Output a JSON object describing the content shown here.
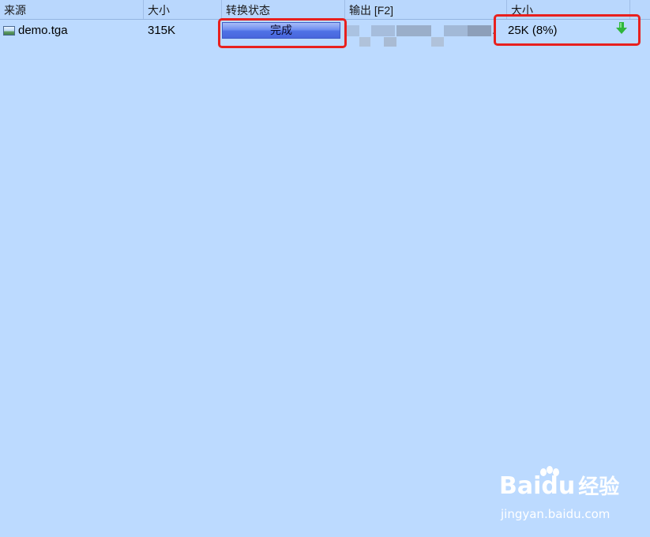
{
  "columns": [
    {
      "label": "来源"
    },
    {
      "label": "大小"
    },
    {
      "label": "转换状态"
    },
    {
      "label": "输出 [F2]"
    },
    {
      "label": "大小"
    }
  ],
  "rows": [
    {
      "source": "demo.tga",
      "size": "315K",
      "status": "完成",
      "status_progress": 1.0,
      "output": "",
      "output_size": "25K  (8%)"
    }
  ],
  "watermark": {
    "brand_left": "Bai",
    "brand_right": "du",
    "brand_suffix": "经验",
    "url": "jingyan.baidu.com"
  },
  "colors": {
    "background": "#bcdaff",
    "progress": "#5577e8",
    "highlight": "#e8201e",
    "arrow": "#2fb63a"
  }
}
